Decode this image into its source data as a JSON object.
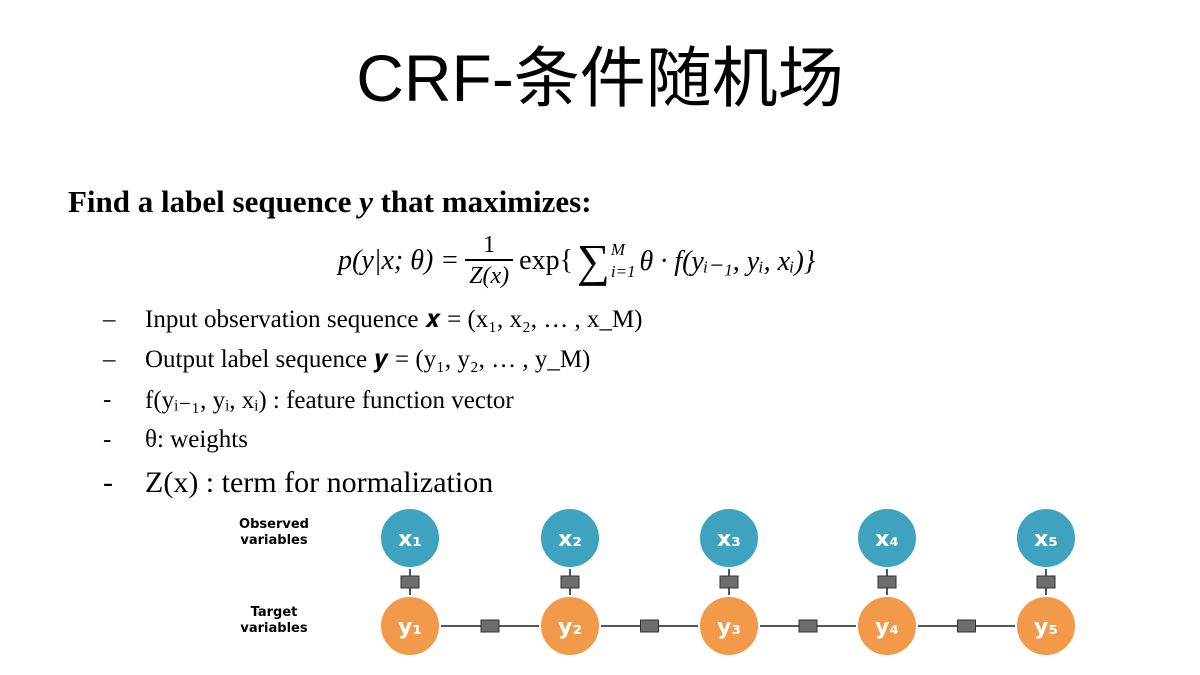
{
  "slide": {
    "title": "CRF-条件随机场",
    "headline": {
      "before": "Find a label sequence",
      "variable": "y",
      "after": "that maximizes:"
    },
    "formula": {
      "lhs": "p(y|x; θ) =",
      "frac_num": "1",
      "frac_den": "Z(x)",
      "exp": "exp{",
      "sum_upper": "M",
      "sum_lower": "i=1",
      "body": "θ · f(yᵢ₋₁, yᵢ, xᵢ)}"
    },
    "bullets": [
      {
        "dash": "–",
        "text": "Input observation sequence 𝒙 = (x₁, x₂, … , x_M)"
      },
      {
        "dash": "–",
        "text": "Output label sequence 𝒚 = (y₁, y₂, … , y_M)"
      },
      {
        "dash": "-",
        "text": "f(yᵢ₋₁, yᵢ, xᵢ) : feature function vector"
      },
      {
        "dash": "-",
        "text": "θ: weights"
      },
      {
        "dash": "-",
        "text": "Z(x) : term for normalization"
      }
    ]
  },
  "diagram": {
    "observed_label": [
      "Observed",
      "variables"
    ],
    "target_label": [
      "Target",
      "variables"
    ],
    "observed_nodes": [
      "x₁",
      "x₂",
      "x₃",
      "x₄",
      "x₅"
    ],
    "target_nodes": [
      "y₁",
      "y₂",
      "y₃",
      "y₄",
      "y₅"
    ],
    "colors": {
      "observed_fill": "#3fa3bf",
      "target_fill": "#f2994a",
      "node_stroke": "#ffffff",
      "connector": "#555555",
      "factor_fill": "#6d6d6d"
    }
  }
}
